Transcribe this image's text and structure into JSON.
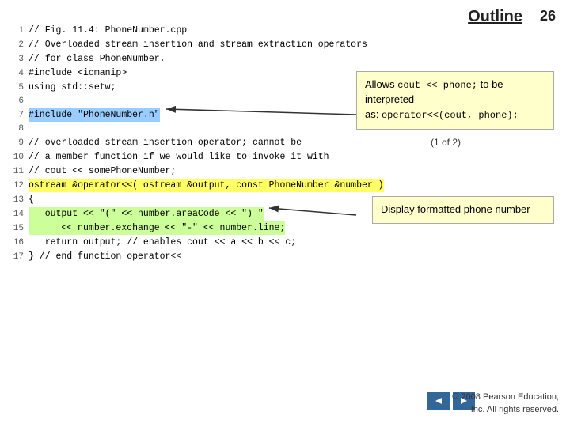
{
  "slide": {
    "number": "26",
    "outline_label": "Outline",
    "code_lines": [
      {
        "num": "1",
        "text": "// Fig. 11.4: PhoneNumber.cpp",
        "highlight": "none"
      },
      {
        "num": "2",
        "text": "// Overloaded stream insertion and stream extraction operators",
        "highlight": "none"
      },
      {
        "num": "3",
        "text": "// for class PhoneNumber.",
        "highlight": "none"
      },
      {
        "num": "4",
        "text": "#include <iomanip>",
        "highlight": "none"
      },
      {
        "num": "5",
        "text": "using std::setw;",
        "highlight": "none"
      },
      {
        "num": "6",
        "text": "",
        "highlight": "none"
      },
      {
        "num": "7",
        "text": "#include \"PhoneNumber.h\"",
        "highlight": "blue"
      },
      {
        "num": "8",
        "text": "",
        "highlight": "none"
      },
      {
        "num": "9",
        "text": "// overloaded stream insertion operator; cannot be",
        "highlight": "none"
      },
      {
        "num": "10",
        "text": "// a member function if we would like to invoke it with",
        "highlight": "none"
      },
      {
        "num": "11",
        "text": "// cout << somePhoneNumber;",
        "highlight": "none"
      },
      {
        "num": "12",
        "text": "ostream &operator<<( ostream &output, const PhoneNumber &number )",
        "highlight": "yellow"
      },
      {
        "num": "13",
        "text": "{",
        "highlight": "none"
      },
      {
        "num": "14",
        "text": "   output << \"(\" << number.areaCode << \") \"",
        "highlight": "green"
      },
      {
        "num": "15",
        "text": "      << number.exchange << \"-\" << number.line;",
        "highlight": "green"
      },
      {
        "num": "16",
        "text": "   return output; // enables cout << a << b << c;",
        "highlight": "none"
      },
      {
        "num": "17",
        "text": "} // end function operator<<",
        "highlight": "none"
      }
    ],
    "callout1": {
      "text_before": "Allows ",
      "code1": "cout << phone;",
      "text_mid": " to be interpreted as: ",
      "code2": "operator<<(cout, phone);",
      "page_ref": "(1 of 2)"
    },
    "callout2": {
      "text": "Display formatted phone number"
    },
    "footer": {
      "line1": "© 2008 Pearson Education,",
      "line2": "Inc.  All rights reserved."
    },
    "nav": {
      "prev_label": "◄",
      "next_label": "►"
    }
  }
}
